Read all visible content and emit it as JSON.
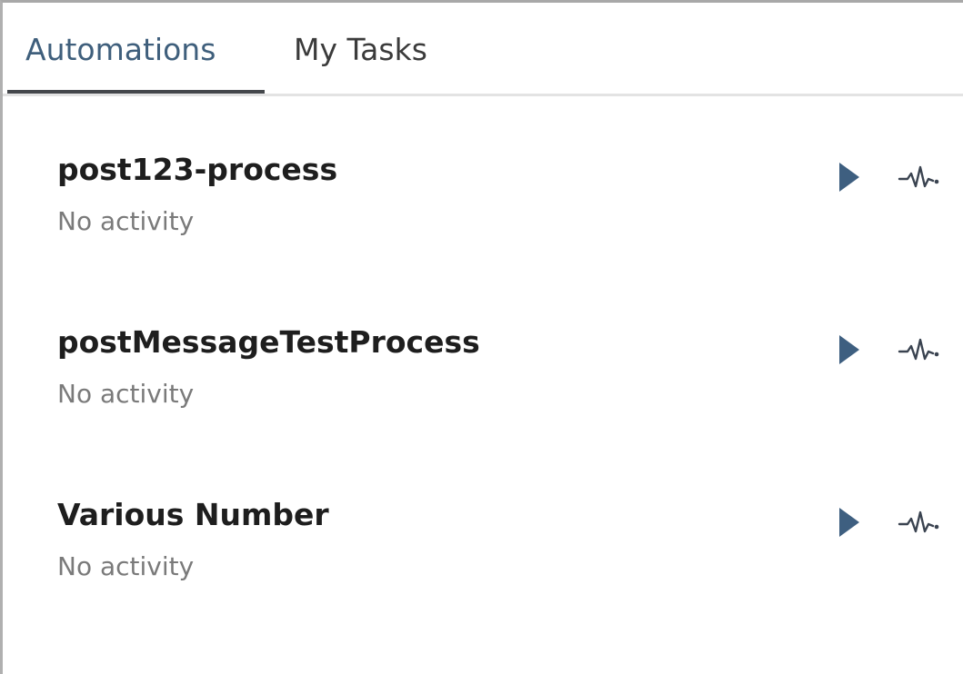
{
  "tabs": [
    {
      "label": "Automations",
      "active": true
    },
    {
      "label": "My Tasks",
      "active": false
    }
  ],
  "automations": [
    {
      "name": "post123-process",
      "status": "No activity"
    },
    {
      "name": "postMessageTestProcess",
      "status": "No activity"
    },
    {
      "name": "Various Number",
      "status": "No activity"
    }
  ],
  "icons": {
    "run": "play-icon",
    "activity": "activity-pulse-icon"
  },
  "colors": {
    "accent": "#3f5f7c",
    "play_icon": "#3e5f80",
    "pulse_icon": "#3a4350",
    "active_tab_underline": "#44474b"
  }
}
